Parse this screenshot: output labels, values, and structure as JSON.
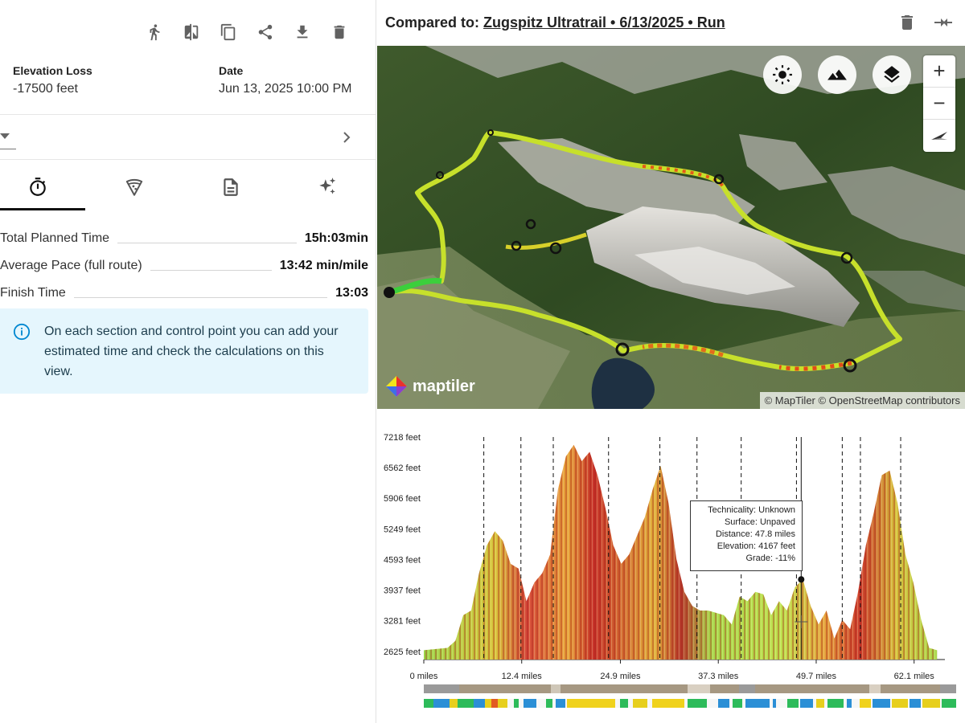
{
  "left": {
    "toolbar": [
      "run-icon",
      "compare-icon",
      "duplicate-icon",
      "share-icon",
      "download-icon",
      "delete-icon"
    ],
    "stats": {
      "elevation_loss_label": "Elevation Loss",
      "elevation_loss_value": "-17500 feet",
      "date_label": "Date",
      "date_value": "Jun 13, 2025 10:00 PM"
    },
    "tabs": [
      "stopwatch-icon",
      "pizza-icon",
      "document-icon",
      "sparkles-icon"
    ],
    "summary": {
      "total_label": "Total Planned Time",
      "total_value": "15h:03min",
      "pace_label": "Average Pace (full route)",
      "pace_value": "13:42 min/mile",
      "finish_label": "Finish Time",
      "finish_value": "13:03"
    },
    "info_text": "On each section and control point you can add your estimated time and check the calculations on this view."
  },
  "right": {
    "compare_prefix": "Compared to: ",
    "compare_link": "Zugspitz Ultratrail • 6/13/2025 • Run",
    "map": {
      "brand": "maptiler",
      "attribution": "© MapTiler © OpenStreetMap contributors",
      "zoom_in": "+",
      "zoom_out": "−"
    },
    "tooltip": {
      "technicality": "Technicality: Unknown",
      "surface": "Surface: Unpaved",
      "distance": "Distance: 47.8 miles",
      "elevation": "Elevation: 4167 feet",
      "grade": "Grade: -11%"
    }
  },
  "chart_data": {
    "type": "area",
    "x_ticks": [
      "0 miles",
      "12.4 miles",
      "24.9 miles",
      "37.3 miles",
      "49.7 miles",
      "62.1 miles"
    ],
    "y_ticks": [
      "7218 feet",
      "6562 feet",
      "5906 feet",
      "5249 feet",
      "4593 feet",
      "3937 feet",
      "3281 feet",
      "2625 feet"
    ],
    "xlim": [
      0,
      66
    ],
    "ylim": [
      2450,
      7218
    ],
    "x": [
      0,
      3,
      4,
      5,
      6,
      7,
      8,
      9,
      10,
      11,
      12,
      13,
      14,
      15,
      16,
      17,
      18,
      19,
      20,
      21,
      22,
      23,
      24,
      25,
      26,
      27,
      28,
      29,
      30,
      31,
      32,
      33,
      34,
      35,
      36,
      37,
      38,
      39,
      40,
      41,
      42,
      43,
      44,
      45,
      46,
      47,
      48,
      49,
      50,
      51,
      52,
      53,
      54,
      55,
      56,
      57,
      58,
      59,
      60,
      61,
      62,
      63,
      64,
      65
    ],
    "elevation": [
      2650,
      2700,
      2850,
      3400,
      3500,
      4300,
      4900,
      5200,
      5000,
      4500,
      4400,
      3700,
      4100,
      4300,
      4700,
      6100,
      6800,
      7050,
      6700,
      6900,
      6400,
      5700,
      4900,
      4500,
      4700,
      5100,
      5500,
      6100,
      6600,
      5800,
      4600,
      3900,
      3600,
      3500,
      3500,
      3450,
      3400,
      3200,
      3800,
      3700,
      3900,
      3850,
      3400,
      3700,
      3500,
      4000,
      4167,
      3600,
      3200,
      3500,
      2900,
      3300,
      3100,
      3900,
      4900,
      5600,
      6400,
      6500,
      5800,
      4700,
      4100,
      3300,
      2700,
      2650
    ],
    "dashed_lines_x": [
      7.6,
      12.3,
      16.4,
      23.4,
      29.9,
      34.6,
      40.2,
      47.2,
      53.0,
      55.3,
      60.4
    ],
    "cursor_line_x": 47.8
  }
}
